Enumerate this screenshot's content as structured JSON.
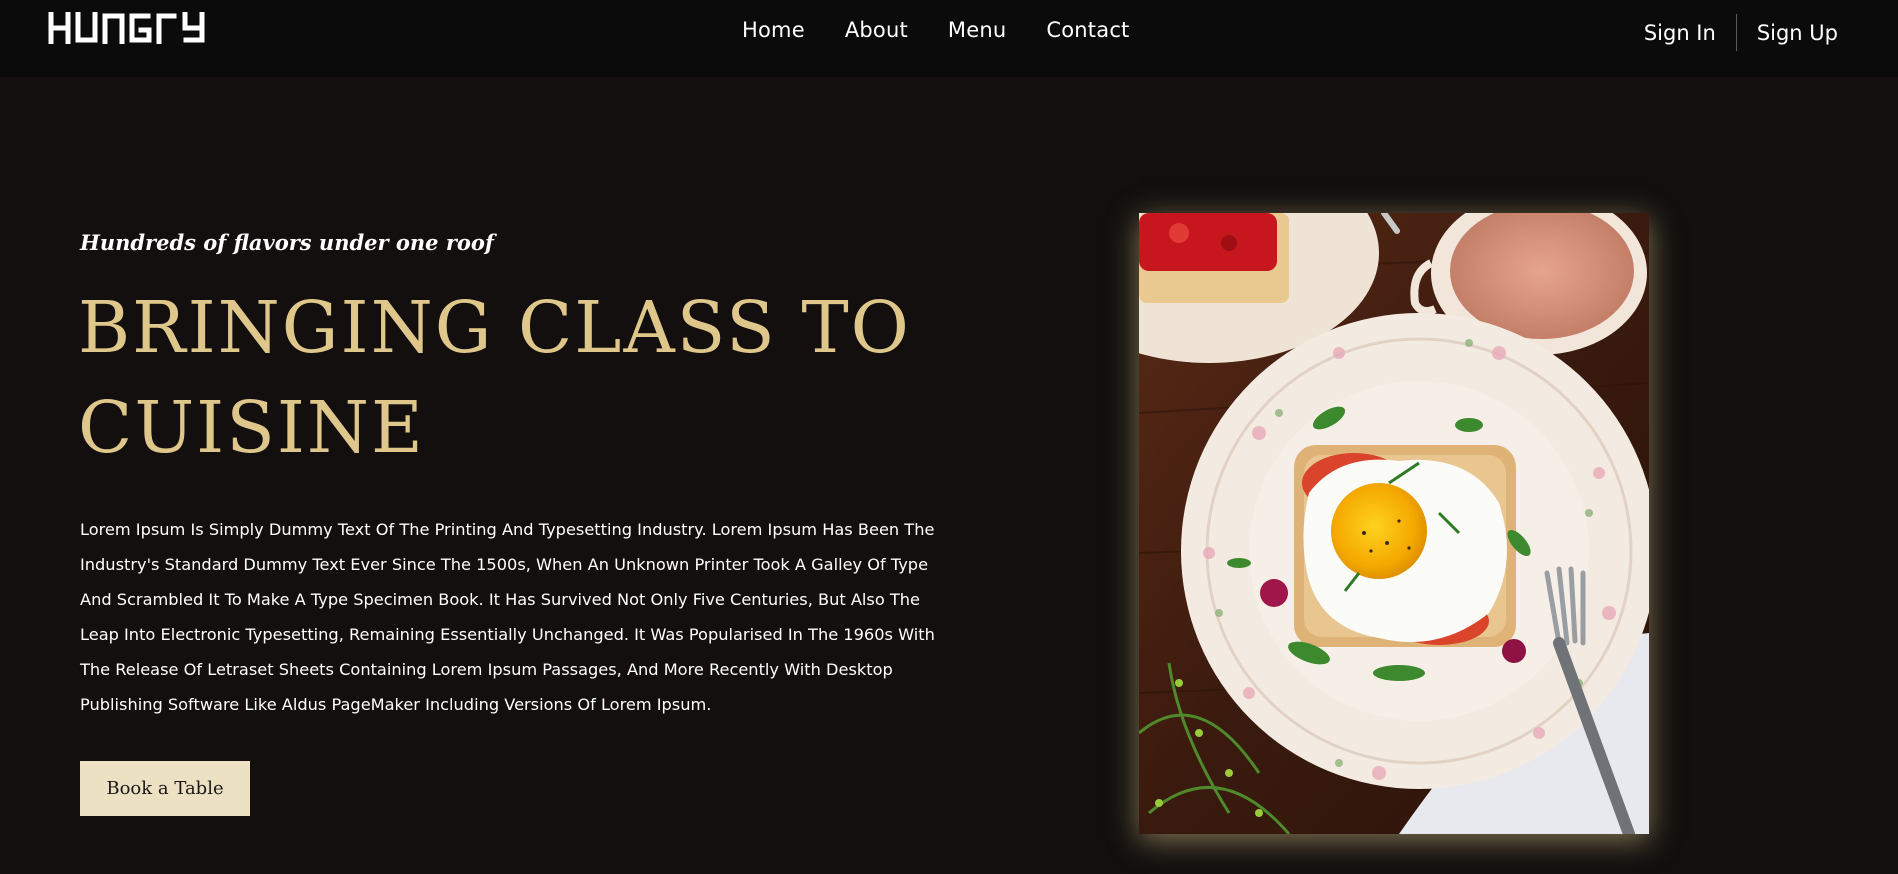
{
  "brand": {
    "logo_text": "HUNGRY"
  },
  "nav": {
    "links": [
      {
        "label": "Home"
      },
      {
        "label": "About"
      },
      {
        "label": "Menu"
      },
      {
        "label": "Contact"
      }
    ]
  },
  "auth": {
    "sign_in": "Sign In",
    "sign_up": "Sign Up"
  },
  "hero": {
    "tagline": "Hundreds of flavors under one roof",
    "headline": "BRINGING CLASS TO CUISINE",
    "body": "Lorem Ipsum Is Simply Dummy Text Of The Printing And Typesetting Industry. Lorem Ipsum Has Been The Industry's Standard Dummy Text Ever Since The 1500s, When An Unknown Printer Took A Galley Of Type And Scrambled It To Make A Type Specimen Book. It Has Survived Not Only Five Centuries, But Also The Leap Into Electronic Typesetting, Remaining Essentially Unchanged. It Was Popularised In The 1960s With The Release Of Letraset Sheets Containing Lorem Ipsum Passages, And More Recently With Desktop Publishing Software Like Aldus PageMaker Including Versions Of Lorem Ipsum.",
    "cta_label": "Book a Table",
    "image_icon": "egg-toast-plate-photo"
  },
  "colors": {
    "background": "#120f0e",
    "nav_background": "#0b0b0b",
    "accent_gold": "#dfc68a",
    "button_bg": "#ede1c4"
  }
}
